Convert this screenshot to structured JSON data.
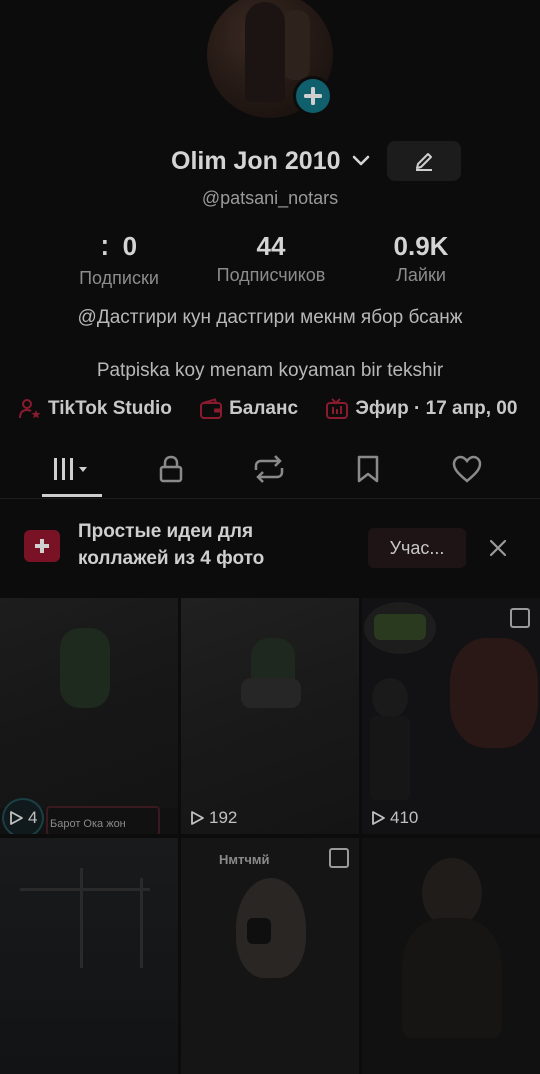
{
  "profile": {
    "display_name": "Olim Jon 2010",
    "username": "@patsani_notars"
  },
  "stats": [
    {
      "value": "0",
      "label": "Подписки"
    },
    {
      "value": "44",
      "label": "Подписчиков"
    },
    {
      "value": "0.9K",
      "label": "Лайки"
    }
  ],
  "bio": {
    "line1": "@Дастгири кун дастгири мекнм ябор бсанж",
    "line2": "Patpiska koy menam  koyaman bir tekshir"
  },
  "links": [
    {
      "label": "TikTok Studio",
      "icon": "person-star-icon"
    },
    {
      "label": "Баланс",
      "icon": "wallet-icon"
    },
    {
      "label": "Эфир · 17 апр, 00",
      "icon": "live-tv-icon"
    }
  ],
  "tabs": [
    {
      "name": "videos",
      "icon": "grid-icon"
    },
    {
      "name": "private",
      "icon": "lock-icon"
    },
    {
      "name": "reposts",
      "icon": "repost-icon"
    },
    {
      "name": "favorites",
      "icon": "bookmark-icon"
    },
    {
      "name": "liked",
      "icon": "heart-icon"
    }
  ],
  "banner": {
    "text": "Простые идеи для коллажей из 4 фото",
    "button": "Учас..."
  },
  "videos": [
    {
      "views": "4",
      "caption": "Барот Ока жон"
    },
    {
      "views": "192"
    },
    {
      "views": "410"
    },
    {
      "views": ""
    },
    {
      "views": "",
      "caption": "Нмтчмй"
    },
    {
      "views": ""
    }
  ],
  "colors": {
    "accent": "#0f5f6c",
    "link_icon": "#8a1a2e",
    "background": "#0c0c0c"
  }
}
